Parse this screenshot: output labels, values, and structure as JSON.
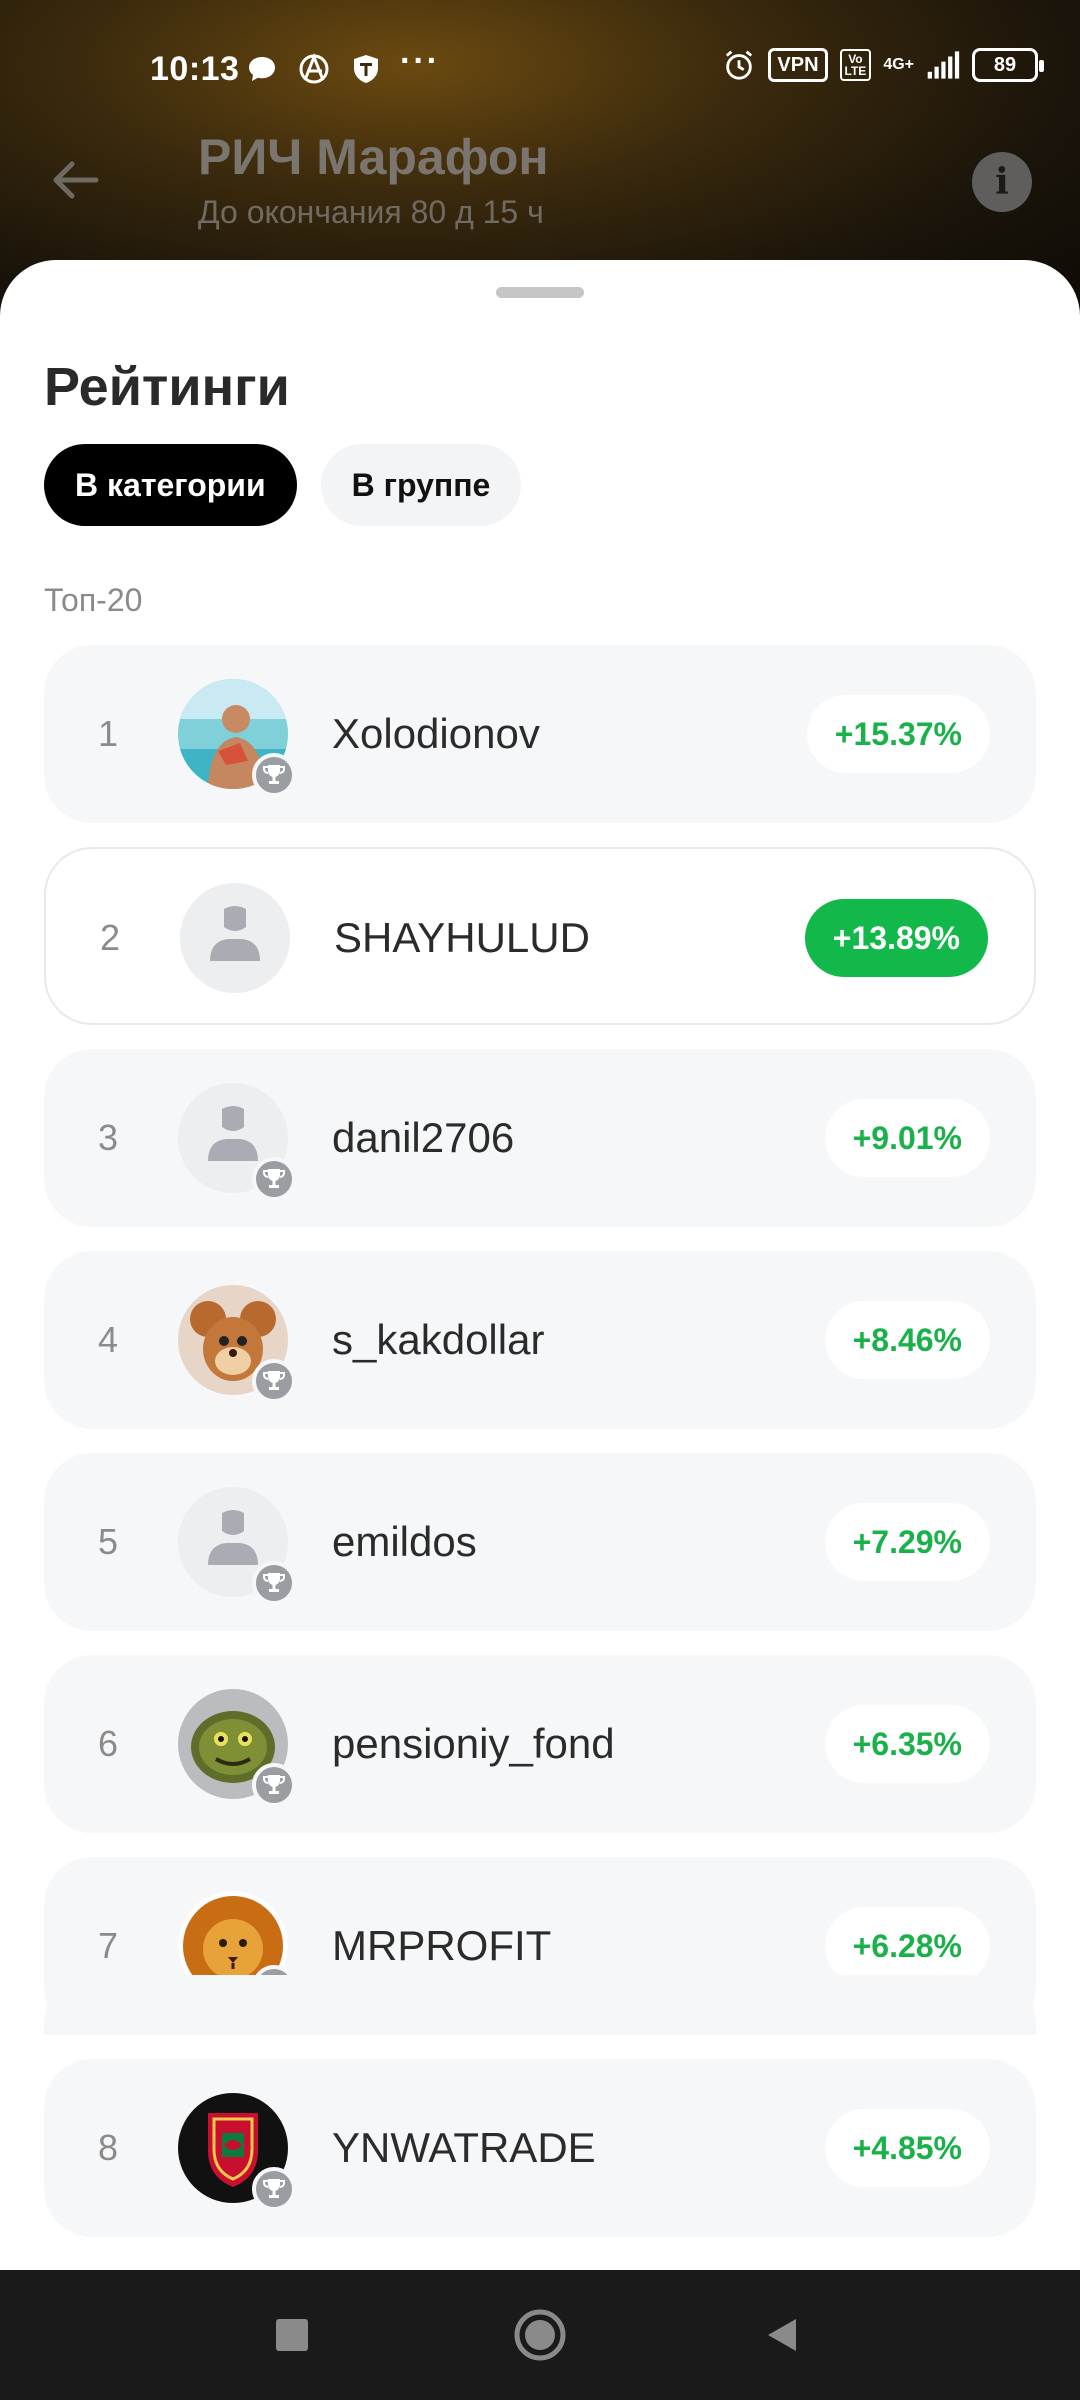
{
  "status_bar": {
    "time": "10:13",
    "vpn": "VPN",
    "volte": "Vo LTE",
    "network": "4G+",
    "battery": "89",
    "more": "···"
  },
  "header": {
    "title": "РИЧ Марафон",
    "subtitle": "До окончания 80 д 15 ч",
    "info_icon_glyph": "i"
  },
  "sheet": {
    "title": "Рейтинги",
    "tabs": [
      {
        "label": "В категории",
        "active": true
      },
      {
        "label": "В группе",
        "active": false
      }
    ],
    "section_label": "Топ-20",
    "rows": [
      {
        "rank": "1",
        "username": "Xolodionov",
        "change": "+15.37%",
        "avatar": "photo-beach",
        "trophy": true
      },
      {
        "rank": "2",
        "username": "SHAYHULUD",
        "change": "+13.89%",
        "avatar": "default-user",
        "trophy": false
      },
      {
        "rank": "3",
        "username": "danil2706",
        "change": "+9.01%",
        "avatar": "default-user",
        "trophy": true
      },
      {
        "rank": "4",
        "username": "s_kakdollar",
        "change": "+8.46%",
        "avatar": "cartoon-mouse",
        "trophy": true
      },
      {
        "rank": "5",
        "username": "emildos",
        "change": "+7.29%",
        "avatar": "default-user",
        "trophy": true
      },
      {
        "rank": "6",
        "username": "pensioniy_fond",
        "change": "+6.35%",
        "avatar": "green-monster",
        "trophy": true
      },
      {
        "rank": "7",
        "username": "MRPROFIT",
        "change": "+6.28%",
        "avatar": "lion",
        "trophy": true
      },
      {
        "rank": "8",
        "username": "YNWATRADE",
        "change": "+4.85%",
        "avatar": "football-crest",
        "trophy": true
      }
    ]
  },
  "colors": {
    "positive": "#1bb14a",
    "positive_active_bg": "#12b84a",
    "tab_active_bg": "#000000"
  }
}
